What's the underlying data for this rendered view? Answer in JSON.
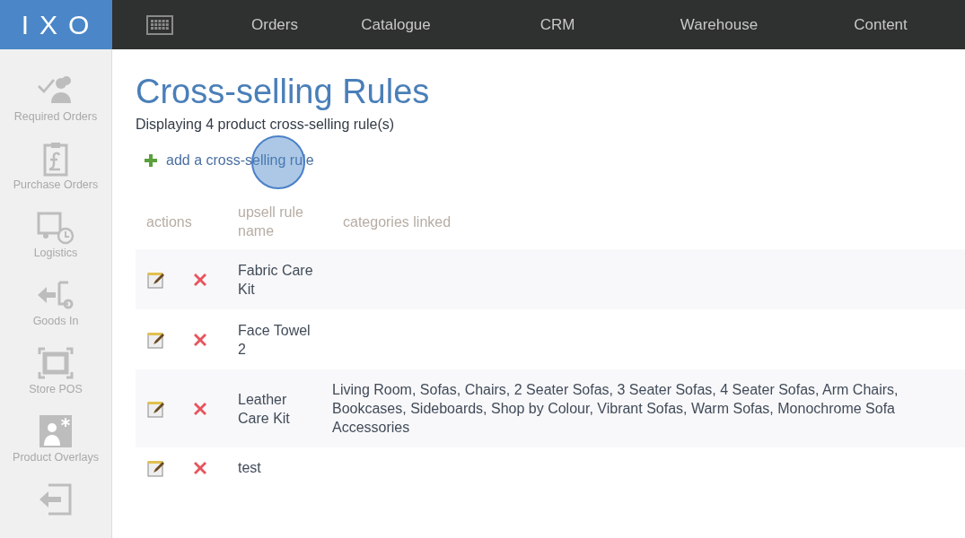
{
  "logo": "IXO",
  "nav": [
    {
      "label": "Orders"
    },
    {
      "label": "Catalogue"
    },
    {
      "label": "CRM"
    },
    {
      "label": "Warehouse"
    },
    {
      "label": "Content"
    }
  ],
  "sidebar": {
    "items": [
      {
        "kind": "required",
        "label": "Required Orders"
      },
      {
        "kind": "purchase",
        "label": "Purchase Orders"
      },
      {
        "kind": "logistics",
        "label": "Logistics"
      },
      {
        "kind": "goods",
        "label": "Goods In"
      },
      {
        "kind": "pos",
        "label": "Store POS"
      },
      {
        "kind": "overlay",
        "label": "Product Overlays"
      },
      {
        "kind": "exit"
      }
    ]
  },
  "page": {
    "title": "Cross-selling Rules",
    "subtitle": "Displaying 4 product cross-selling rule(s)",
    "add_link": "add a cross-selling rule"
  },
  "table": {
    "columns": [
      "actions",
      "upsell rule name",
      "categories linked"
    ],
    "rows": [
      {
        "name": "Fabric Care Kit",
        "categories": []
      },
      {
        "name": "Face Towel 2",
        "categories": []
      },
      {
        "name": "Leather Care Kit",
        "categories": [
          "Living Room, Sofas, Chairs, 2 Seater Sofas, 3 Seater Sofas, 4 Seater Sofas, Arm Chairs,",
          "Bookcases, Sideboards, Shop by Colour, Vibrant Sofas, Warm Sofas, Monochrome Sofa",
          "Accessories"
        ]
      },
      {
        "name": "test",
        "categories": []
      }
    ]
  }
}
